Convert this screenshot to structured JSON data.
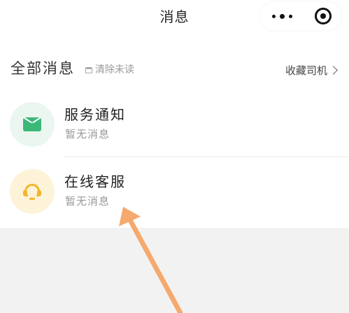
{
  "nav": {
    "title": "消息"
  },
  "header": {
    "title": "全部消息",
    "clear_unread": "清除未读",
    "fav_drivers": "收藏司机"
  },
  "messages": [
    {
      "title": "服务通知",
      "subtitle": "暂无消息",
      "icon": "mail-icon",
      "icon_color": "#3cb878"
    },
    {
      "title": "在线客服",
      "subtitle": "暂无消息",
      "icon": "headset-icon",
      "icon_color": "#f4b52a"
    }
  ],
  "annotation": {
    "arrow_color": "#f5a96e"
  }
}
